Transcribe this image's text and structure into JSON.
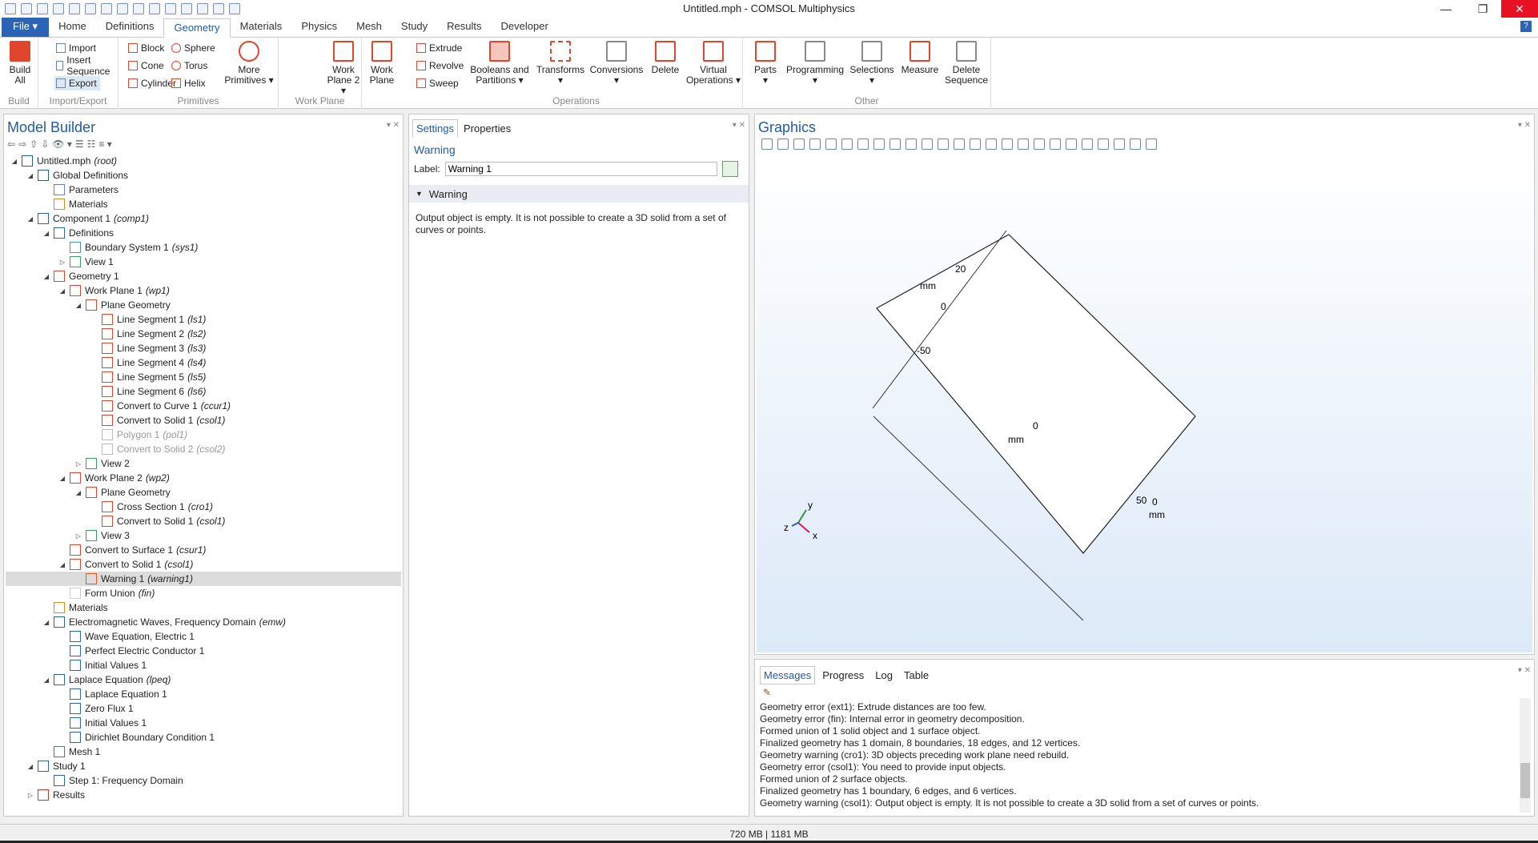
{
  "title": "Untitled.mph - COMSOL Multiphysics",
  "tabs": [
    "Home",
    "Definitions",
    "Geometry",
    "Materials",
    "Physics",
    "Mesh",
    "Study",
    "Results",
    "Developer"
  ],
  "file_label": "File ▾",
  "ribbon": {
    "build": {
      "btn1": "Build",
      "btn2": "All",
      "group": "Build"
    },
    "impexp": {
      "import": "Import",
      "insert": "Insert Sequence",
      "export": "Export",
      "group": "Import/Export"
    },
    "prim": {
      "block": "Block",
      "cone": "Cone",
      "cylinder": "Cylinder",
      "sphere": "Sphere",
      "torus": "Torus",
      "helix": "Helix",
      "more1": "More",
      "more2": "Primitives ▾",
      "group": "Primitives"
    },
    "wp": {
      "wp2a": "Work",
      "wp2b": "Plane 2 ▾",
      "wpa": "Work",
      "wpb": "Plane",
      "group": "Work Plane"
    },
    "ops": {
      "extrude": "Extrude",
      "revolve": "Revolve",
      "sweep": "Sweep",
      "bool1": "Booleans and",
      "bool2": "Partitions ▾",
      "trans": "Transforms",
      "trans2": "▾",
      "conv": "Conversions",
      "conv2": "▾",
      "delete": "Delete",
      "virt1": "Virtual",
      "virt2": "Operations ▾",
      "group": "Operations"
    },
    "other": {
      "parts": "Parts",
      "parts2": "▾",
      "prog": "Programming",
      "prog2": "▾",
      "sel": "Selections",
      "sel2": "▾",
      "meas": "Measure",
      "del1": "Delete",
      "del2": "Sequence",
      "group": "Other"
    }
  },
  "model_builder": {
    "title": "Model Builder"
  },
  "tree": [
    {
      "t": "Untitled.mph",
      "tag": "(root)",
      "lv": 0,
      "tog": "◢",
      "ic": "#1f5ba8"
    },
    {
      "t": "Global Definitions",
      "tag": "",
      "lv": 1,
      "tog": "◢",
      "ic": "#1f5ba8"
    },
    {
      "t": "Parameters",
      "tag": "",
      "lv": 2,
      "tog": "",
      "ic": "#6a7fb0"
    },
    {
      "t": "Materials",
      "tag": "",
      "lv": 2,
      "tog": "",
      "ic": "#e08a1e"
    },
    {
      "t": "Component 1",
      "tag": "(comp1)",
      "lv": 1,
      "tog": "◢",
      "ic": "#2b64b4"
    },
    {
      "t": "Definitions",
      "tag": "",
      "lv": 2,
      "tog": "◢",
      "ic": "#2b64b4"
    },
    {
      "t": "Boundary System 1",
      "tag": "(sys1)",
      "lv": 3,
      "tog": "",
      "ic": "#4a90c8"
    },
    {
      "t": "View 1",
      "tag": "",
      "lv": 3,
      "tog": "▷",
      "ic": "#3aa05a"
    },
    {
      "t": "Geometry 1",
      "tag": "",
      "lv": 2,
      "tog": "◢",
      "ic": "#e0452e"
    },
    {
      "t": "Work Plane 1",
      "tag": "(wp1)",
      "lv": 3,
      "tog": "◢",
      "ic": "#e0452e"
    },
    {
      "t": "Plane Geometry",
      "tag": "",
      "lv": 4,
      "tog": "◢",
      "ic": "#e0452e"
    },
    {
      "t": "Line Segment 1",
      "tag": "(ls1)",
      "lv": 5,
      "tog": "",
      "ic": "#e0452e"
    },
    {
      "t": "Line Segment 2",
      "tag": "(ls2)",
      "lv": 5,
      "tog": "",
      "ic": "#e0452e"
    },
    {
      "t": "Line Segment 3",
      "tag": "(ls3)",
      "lv": 5,
      "tog": "",
      "ic": "#e0452e"
    },
    {
      "t": "Line Segment 4",
      "tag": "(ls4)",
      "lv": 5,
      "tog": "",
      "ic": "#e0452e"
    },
    {
      "t": "Line Segment 5",
      "tag": "(ls5)",
      "lv": 5,
      "tog": "",
      "ic": "#e0452e"
    },
    {
      "t": "Line Segment 6",
      "tag": "(ls6)",
      "lv": 5,
      "tog": "",
      "ic": "#e0452e"
    },
    {
      "t": "Convert to Curve 1",
      "tag": "(ccur1)",
      "lv": 5,
      "tog": "",
      "ic": "#e0452e"
    },
    {
      "t": "Convert to Solid 1",
      "tag": "(csol1)",
      "lv": 5,
      "tog": "",
      "ic": "#e0452e"
    },
    {
      "t": "Polygon 1",
      "tag": "(pol1)",
      "lv": 5,
      "tog": "",
      "ic": "#bbb",
      "dis": true
    },
    {
      "t": "Convert to Solid 2",
      "tag": "(csol2)",
      "lv": 5,
      "tog": "",
      "ic": "#bbb",
      "dis": true
    },
    {
      "t": "View 2",
      "tag": "",
      "lv": 4,
      "tog": "▷",
      "ic": "#3aa05a"
    },
    {
      "t": "Work Plane 2",
      "tag": "(wp2)",
      "lv": 3,
      "tog": "◢",
      "ic": "#e0452e"
    },
    {
      "t": "Plane Geometry",
      "tag": "",
      "lv": 4,
      "tog": "◢",
      "ic": "#e0452e"
    },
    {
      "t": "Cross Section 1",
      "tag": "(cro1)",
      "lv": 5,
      "tog": "",
      "ic": "#e0452e"
    },
    {
      "t": "Convert to Solid 1",
      "tag": "(csol1)",
      "lv": 5,
      "tog": "",
      "ic": "#e0452e"
    },
    {
      "t": "View 3",
      "tag": "",
      "lv": 4,
      "tog": "▷",
      "ic": "#3aa05a"
    },
    {
      "t": "Convert to Surface 1",
      "tag": "(csur1)",
      "lv": 3,
      "tog": "",
      "ic": "#e0452e"
    },
    {
      "t": "Convert to Solid 1",
      "tag": "(csol1)",
      "lv": 3,
      "tog": "◢",
      "ic": "#e0452e"
    },
    {
      "t": "Warning 1",
      "tag": "(warning1)",
      "lv": 4,
      "tog": "",
      "ic": "#e8561e",
      "sel": true
    },
    {
      "t": "Form Union",
      "tag": "(fin)",
      "lv": 3,
      "tog": "",
      "ic": "#ccc"
    },
    {
      "t": "Materials",
      "tag": "",
      "lv": 2,
      "tog": "",
      "ic": "#e08a1e"
    },
    {
      "t": "Electromagnetic Waves, Frequency Domain",
      "tag": "(emw)",
      "lv": 2,
      "tog": "◢",
      "ic": "#2b64b4"
    },
    {
      "t": "Wave Equation, Electric 1",
      "tag": "",
      "lv": 3,
      "tog": "",
      "ic": "#2b64b4"
    },
    {
      "t": "Perfect Electric Conductor 1",
      "tag": "",
      "lv": 3,
      "tog": "",
      "ic": "#2b64b4"
    },
    {
      "t": "Initial Values 1",
      "tag": "",
      "lv": 3,
      "tog": "",
      "ic": "#2b64b4"
    },
    {
      "t": "Laplace Equation",
      "tag": "(lpeq)",
      "lv": 2,
      "tog": "◢",
      "ic": "#2b64b4"
    },
    {
      "t": "Laplace Equation 1",
      "tag": "",
      "lv": 3,
      "tog": "",
      "ic": "#2b64b4"
    },
    {
      "t": "Zero Flux 1",
      "tag": "",
      "lv": 3,
      "tog": "",
      "ic": "#2b64b4"
    },
    {
      "t": "Initial Values 1",
      "tag": "",
      "lv": 3,
      "tog": "",
      "ic": "#2b64b4"
    },
    {
      "t": "Dirichlet Boundary Condition 1",
      "tag": "",
      "lv": 3,
      "tog": "",
      "ic": "#2b64b4"
    },
    {
      "t": "Mesh 1",
      "tag": "",
      "lv": 2,
      "tog": "",
      "ic": "#5a6f8a"
    },
    {
      "t": "Study 1",
      "tag": "",
      "lv": 1,
      "tog": "◢",
      "ic": "#2b64b4"
    },
    {
      "t": "Step 1: Frequency Domain",
      "tag": "",
      "lv": 2,
      "tog": "",
      "ic": "#2b64b4"
    },
    {
      "t": "Results",
      "tag": "",
      "lv": 1,
      "tog": "▷",
      "ic": "#c0392b"
    }
  ],
  "settings": {
    "tab1": "Settings",
    "tab2": "Properties",
    "heading": "Warning",
    "label_caption": "Label:",
    "label_value": "Warning 1",
    "section": "Warning",
    "message": "Output object is empty. It is not possible to create a 3D solid from a set of curves or points."
  },
  "graphics": {
    "title": "Graphics",
    "ticks": [
      "20",
      "mm",
      "0",
      "-50",
      "0",
      "mm",
      "50",
      "0",
      "mm"
    ],
    "axes": [
      "y",
      "z",
      "x"
    ]
  },
  "messages": {
    "tabs": [
      "Messages",
      "Progress",
      "Log",
      "Table"
    ],
    "lines": [
      "Geometry error (ext1): Extrude distances are too few.",
      "Geometry error (fin): Internal error in geometry decomposition.",
      "Formed union of 1 solid object and 1 surface object.",
      "Finalized geometry has 1 domain, 8 boundaries, 18 edges, and 12 vertices.",
      "Geometry warning (cro1): 3D objects preceding work plane need rebuild.",
      "Geometry error (csol1): You need to provide input objects.",
      "Formed union of 2 surface objects.",
      "Finalized geometry has 1 boundary, 6 edges, and 6 vertices.",
      "Geometry warning (csol1): Output object is empty. It is not possible to create a 3D solid from a set of curves or points."
    ]
  },
  "status": "720 MB | 1181 MB",
  "colors": {
    "accent": "#1f5ba8",
    "geometry": "#e0452e",
    "file_tab": "#2b64b4",
    "close": "#e81123"
  }
}
